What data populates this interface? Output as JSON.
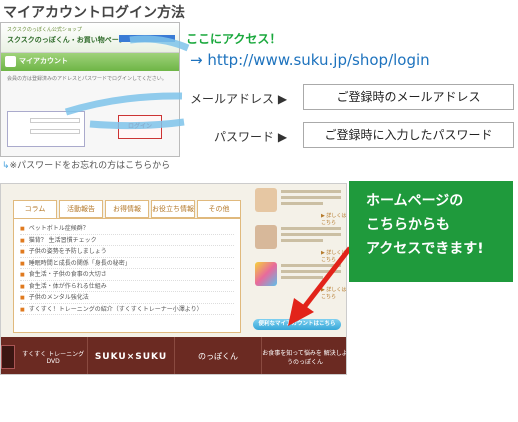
{
  "page": {
    "title": "マイアカウントログイン方法"
  },
  "access": {
    "heading": "ここにアクセス！",
    "url": "→ http://www.suku.jp/shop/login"
  },
  "mini_screenshot": {
    "site_title": "スクスクのっぽくん・お買い物ページ",
    "site_small": "スクスクのっぽくん公式ショップ",
    "section": "マイアカウント",
    "body_text": "会員の方は登録済みのアドレスとパスワードでログインしてください。",
    "field_mail": "メールアドレス",
    "field_pass": "パスワード",
    "login_button": "ログイン"
  },
  "password_note": {
    "arrow": "↳",
    "text": "※パスワードをお忘れの方はこちらから"
  },
  "fields": [
    {
      "label": "メールアドレス ▶",
      "value": "ご登録時のメールアドレス"
    },
    {
      "label": "パスワード ▶",
      "value": "ご登録時に入力したパスワード"
    }
  ],
  "site": {
    "tabs": [
      "コラム",
      "活動報告",
      "お得情報",
      "お役立ち情報",
      "その他"
    ],
    "list_items": [
      "ペットボトル症候群？",
      "猫背？ 生活習慣チェック",
      "子供の姿勢を予防しましょう",
      "睡眠時間と成長の関係「身長の秘密」",
      "食生活・子供の食事の大切さ",
      "食生活・体が作られる仕組み",
      "子供のメンタル強化法",
      "すくすく！トレーニングの紹介（すくすくトレーナー小澤より）"
    ],
    "side_more": "▶ 詳しくはこちら",
    "mypage_button": "便利なマイアカウントはこちら",
    "footer": [
      "すくすく トレーニング DVD",
      "SUKU×SUKU",
      "のっぽくん",
      "お食事を知って悩みを 解決しようのっぽくん"
    ]
  },
  "callout": {
    "lines": [
      "ホームページの",
      "こちらからも",
      "アクセスできます!"
    ]
  },
  "colors": {
    "green": "#1f9a3c",
    "blue_url": "#1e73be",
    "arrow_red": "#e2231a",
    "arrow_blue": "#4aa3df"
  }
}
